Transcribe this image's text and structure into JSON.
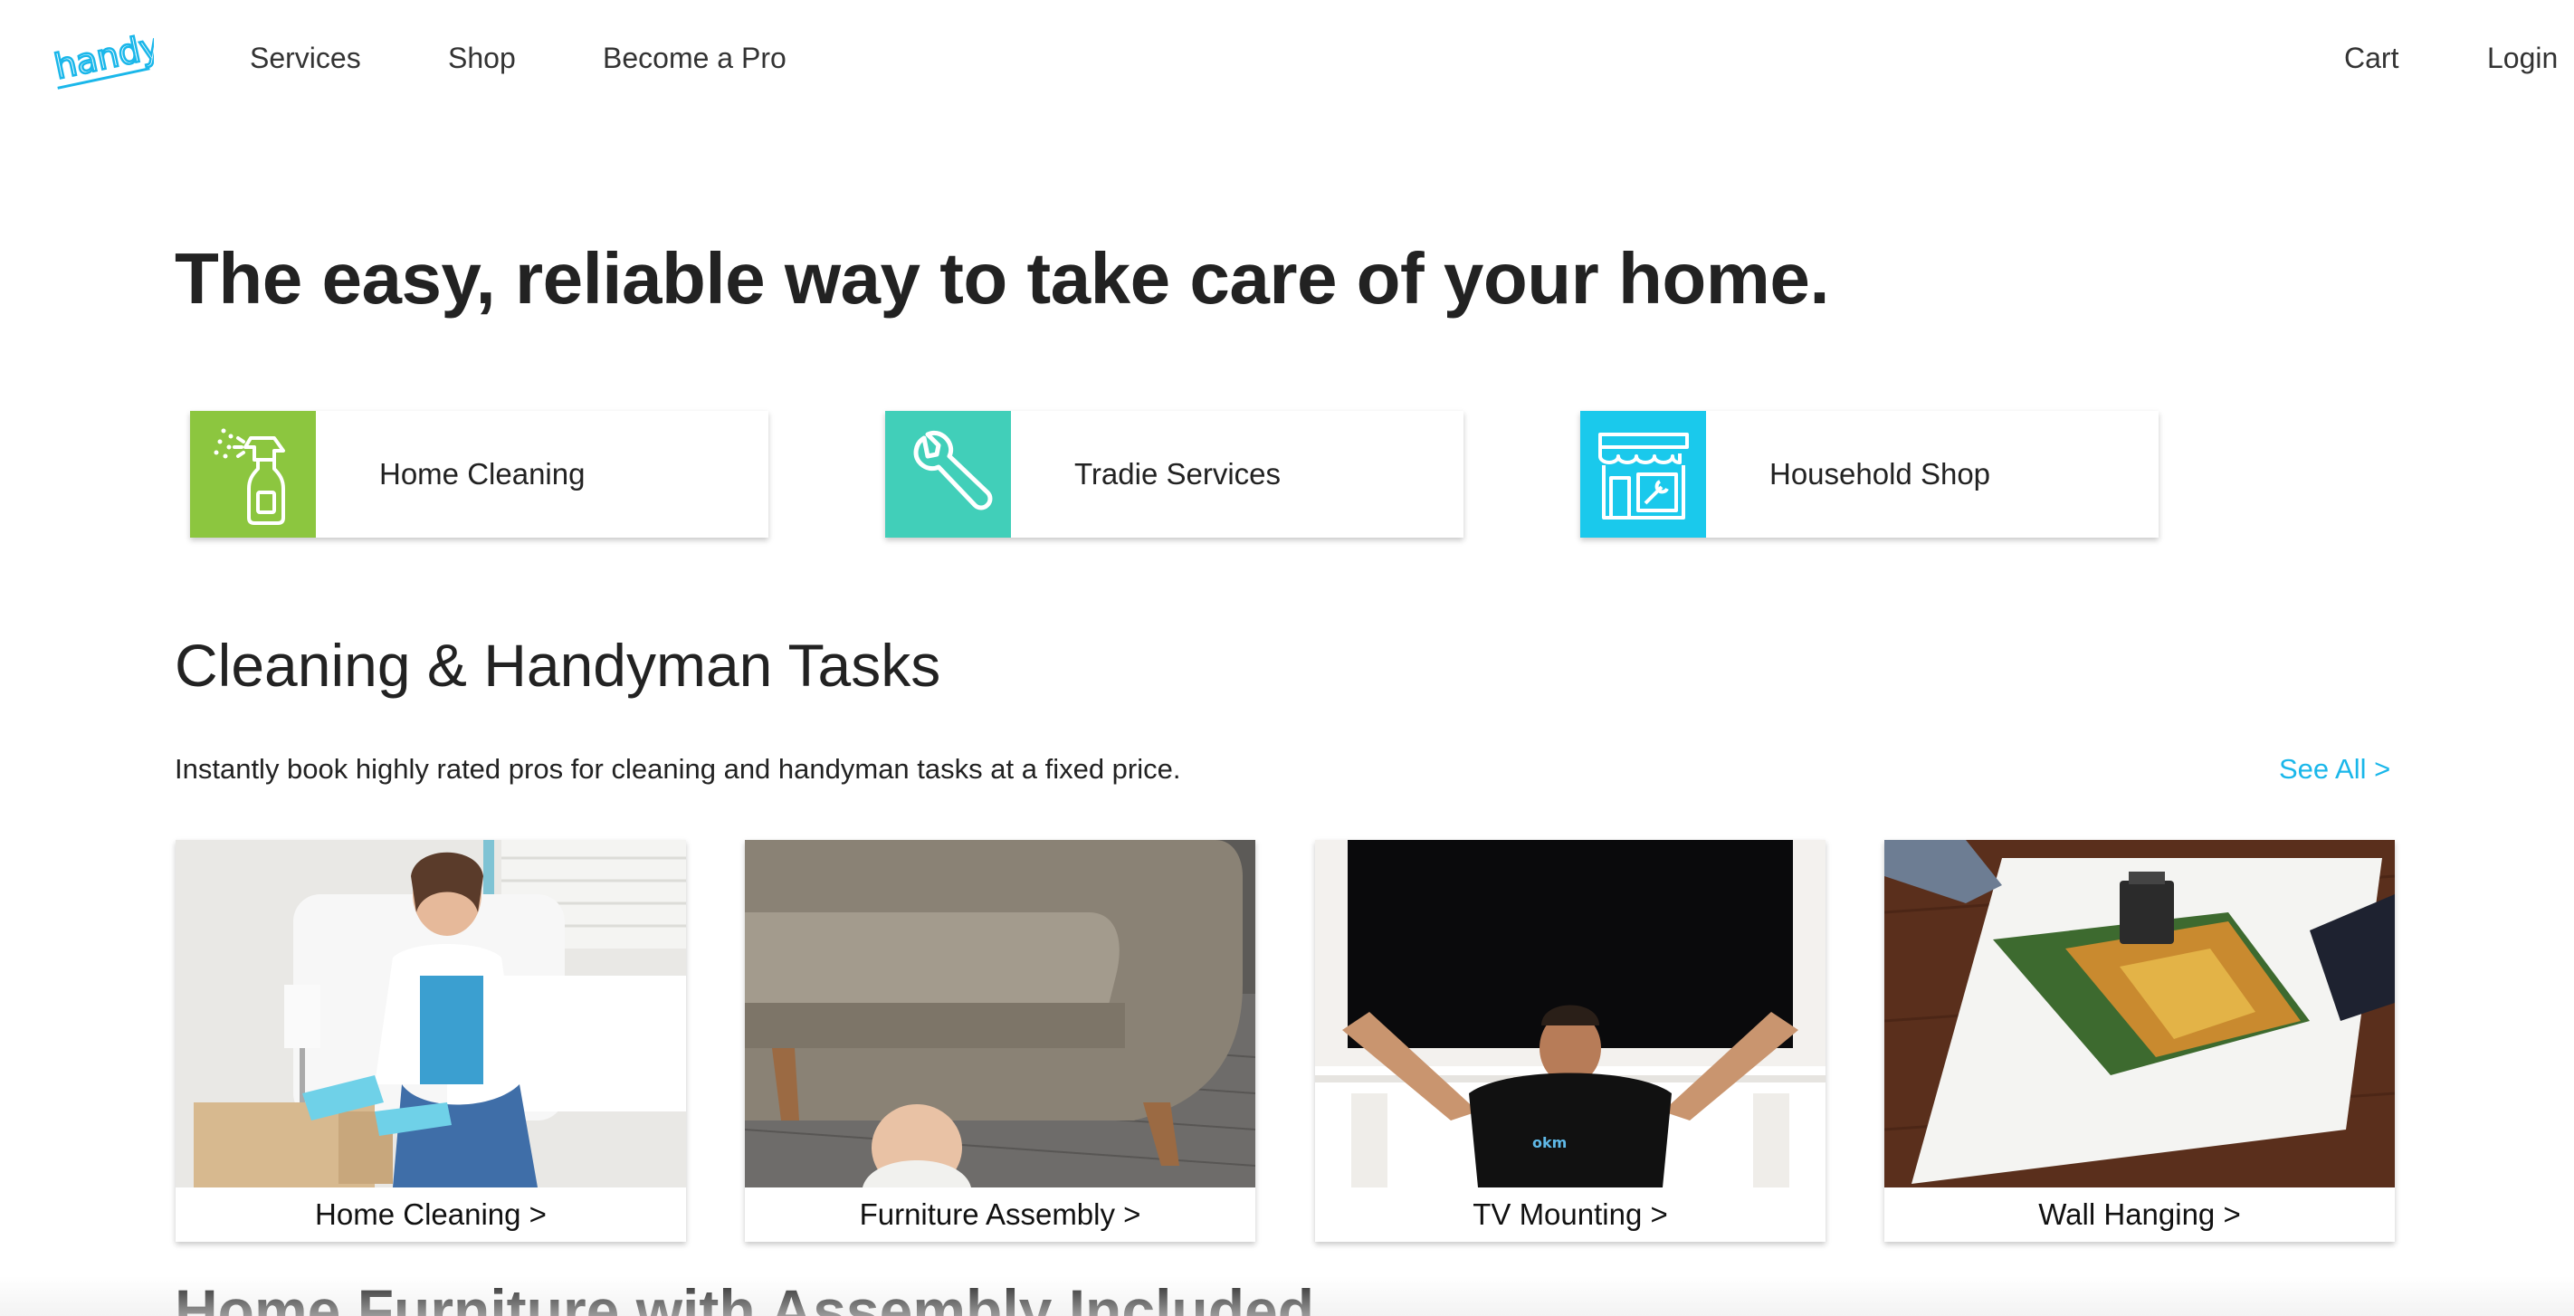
{
  "header": {
    "logo_text": "handy",
    "nav": [
      {
        "label": "Services"
      },
      {
        "label": "Shop"
      },
      {
        "label": "Become a Pro"
      }
    ],
    "cart_label": "Cart",
    "login_label": "Login"
  },
  "hero": {
    "title": "The easy, reliable way to take care of your home."
  },
  "categories": [
    {
      "label": "Home Cleaning",
      "icon": "spray-bottle-icon",
      "color": "#8cc63f"
    },
    {
      "label": "Tradie Services",
      "icon": "wrench-icon",
      "color": "#41cfb9"
    },
    {
      "label": "Household Shop",
      "icon": "storefront-icon",
      "color": "#1ac9ec"
    }
  ],
  "tasks_section": {
    "title": "Cleaning & Handyman Tasks",
    "subtitle": "Instantly book highly rated pros for cleaning and handyman tasks at a fixed price.",
    "see_all": "See All >",
    "items": [
      {
        "label": "Home Cleaning >"
      },
      {
        "label": "Furniture Assembly >"
      },
      {
        "label": "TV Mounting >"
      },
      {
        "label": "Wall Hanging >"
      }
    ]
  },
  "furniture_section": {
    "title": "Home Furniture with Assembly Included"
  },
  "colors": {
    "accent": "#1ab7ea",
    "green": "#8cc63f",
    "teal": "#41cfb9",
    "cyan": "#1ac9ec"
  }
}
